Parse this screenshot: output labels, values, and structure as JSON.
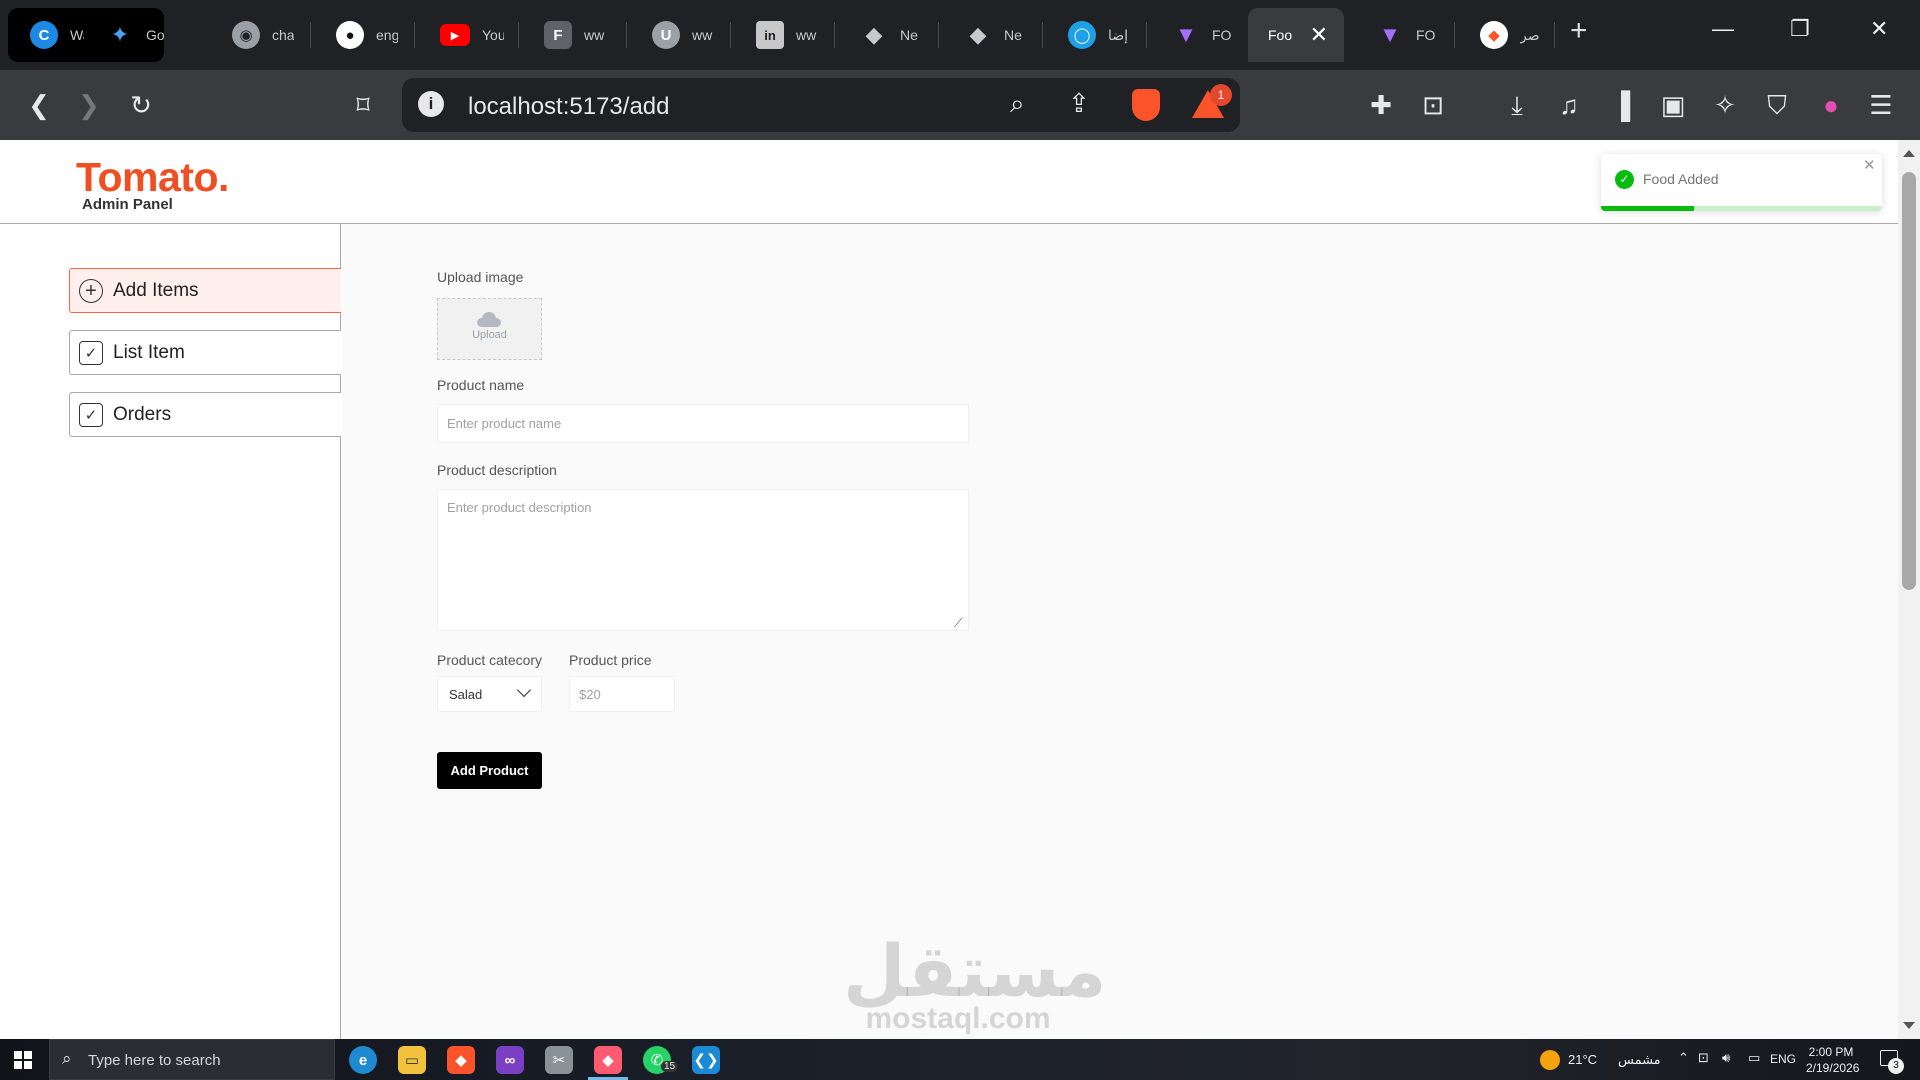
{
  "browser": {
    "tabs": [
      {
        "title": "Wa",
        "icon": "C"
      },
      {
        "title": "Go",
        "icon": "✦"
      },
      {
        "title": "cha",
        "icon": "◉"
      },
      {
        "title": "eng",
        "icon": "●"
      },
      {
        "title": "You",
        "icon": "▶"
      },
      {
        "title": "ww",
        "icon": "F"
      },
      {
        "title": "ww",
        "icon": "U"
      },
      {
        "title": "ww",
        "icon": "in"
      },
      {
        "title": "Ne",
        "icon": "◆"
      },
      {
        "title": "Ne",
        "icon": "◆"
      },
      {
        "title": "إضا",
        "icon": "◯"
      },
      {
        "title": "FO",
        "icon": "▼"
      },
      {
        "title": "Foo",
        "icon": ""
      },
      {
        "title": "FO",
        "icon": "▼"
      },
      {
        "title": "صر",
        "icon": "◆"
      }
    ],
    "url": "localhost:5173/add",
    "rewards_count": "1"
  },
  "admin": {
    "logo": "Tomato.",
    "subtitle": "Admin Panel",
    "sidebar": [
      {
        "label": "Add Items",
        "icon": "plus-circle-icon",
        "active": true
      },
      {
        "label": "List Item",
        "icon": "checkbox-icon",
        "active": false
      },
      {
        "label": "Orders",
        "icon": "checkbox-icon",
        "active": false
      }
    ]
  },
  "form": {
    "upload_label": "Upload image",
    "upload_text": "Upload",
    "name_label": "Product name",
    "name_placeholder": "Enter product name",
    "desc_label": "Product description",
    "desc_placeholder": "Enter product description",
    "category_label": "Product catecory",
    "category_value": "Salad",
    "price_label": "Product price",
    "price_placeholder": "$20",
    "submit_label": "Add Product"
  },
  "toast": {
    "message": "Food Added",
    "progress": 0.33
  },
  "watermark": {
    "arabic": "مستقل",
    "latin": "mostaql.com"
  },
  "taskbar": {
    "search_placeholder": "Type here to search",
    "weather_temp": "21°C",
    "weather_desc": "مشمس",
    "language": "ENG",
    "time": "2:00 PM",
    "date": "2/19/2026",
    "whatsapp_badge": "15",
    "notifications": "3"
  },
  "colors": {
    "brand": "#f04f23",
    "active_border": "#ff6347",
    "active_bg": "#fff0ed",
    "toast_success": "#07bc0c"
  }
}
